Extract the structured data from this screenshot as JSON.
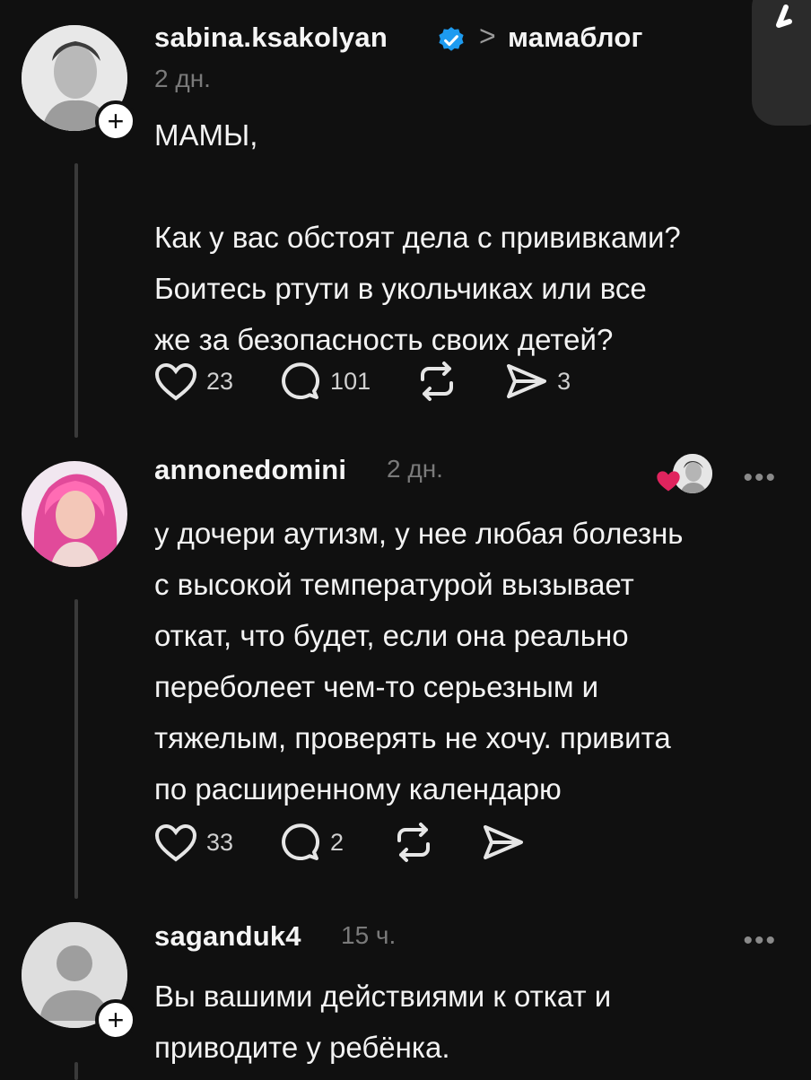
{
  "post": {
    "username": "sabina.ksakolyan",
    "separator": ">",
    "topic": "мамаблог",
    "time": "2 дн.",
    "text": "МАМЫ,\n\nКак у вас обстоят дела с прививками?\nБоитесь ртути в укольчиках или все\nже за безопасность своих детей?",
    "likes": "23",
    "replies": "101",
    "shares": "3"
  },
  "reply1": {
    "username": "annonedomini",
    "time": "2 дн.",
    "text": "у дочери аутизм, у нее любая болезнь\nс высокой температурой вызывает\nоткат, что будет, если она реально\nпереболеет чем-то серьезным и\nтяжелым, проверять не хочу. привита\nпо расширенному календарю",
    "likes": "33",
    "replies": "2"
  },
  "reply2": {
    "username": "saganduk4",
    "time": "15 ч.",
    "text": "Вы вашими действиями к откат  и\nприводите у ребёнка."
  },
  "ui": {
    "more": "•••",
    "plus": "+",
    "accent_blue": "#1d9bf0",
    "heart_red": "#e0245e"
  }
}
